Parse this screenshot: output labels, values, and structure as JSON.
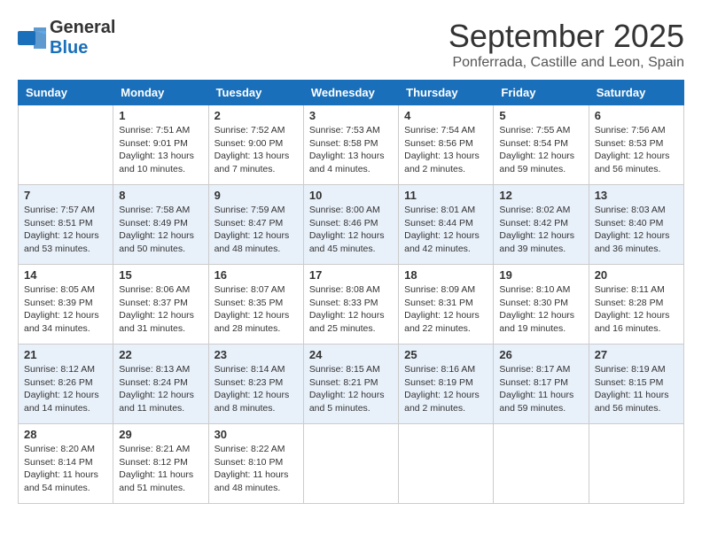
{
  "header": {
    "logo_general": "General",
    "logo_blue": "Blue",
    "month": "September 2025",
    "location": "Ponferrada, Castille and Leon, Spain"
  },
  "days_of_week": [
    "Sunday",
    "Monday",
    "Tuesday",
    "Wednesday",
    "Thursday",
    "Friday",
    "Saturday"
  ],
  "weeks": [
    [
      {
        "day": "",
        "empty": true
      },
      {
        "day": "1",
        "sunrise": "Sunrise: 7:51 AM",
        "sunset": "Sunset: 9:01 PM",
        "daylight": "Daylight: 13 hours and 10 minutes."
      },
      {
        "day": "2",
        "sunrise": "Sunrise: 7:52 AM",
        "sunset": "Sunset: 9:00 PM",
        "daylight": "Daylight: 13 hours and 7 minutes."
      },
      {
        "day": "3",
        "sunrise": "Sunrise: 7:53 AM",
        "sunset": "Sunset: 8:58 PM",
        "daylight": "Daylight: 13 hours and 4 minutes."
      },
      {
        "day": "4",
        "sunrise": "Sunrise: 7:54 AM",
        "sunset": "Sunset: 8:56 PM",
        "daylight": "Daylight: 13 hours and 2 minutes."
      },
      {
        "day": "5",
        "sunrise": "Sunrise: 7:55 AM",
        "sunset": "Sunset: 8:54 PM",
        "daylight": "Daylight: 12 hours and 59 minutes."
      },
      {
        "day": "6",
        "sunrise": "Sunrise: 7:56 AM",
        "sunset": "Sunset: 8:53 PM",
        "daylight": "Daylight: 12 hours and 56 minutes."
      }
    ],
    [
      {
        "day": "7",
        "sunrise": "Sunrise: 7:57 AM",
        "sunset": "Sunset: 8:51 PM",
        "daylight": "Daylight: 12 hours and 53 minutes."
      },
      {
        "day": "8",
        "sunrise": "Sunrise: 7:58 AM",
        "sunset": "Sunset: 8:49 PM",
        "daylight": "Daylight: 12 hours and 50 minutes."
      },
      {
        "day": "9",
        "sunrise": "Sunrise: 7:59 AM",
        "sunset": "Sunset: 8:47 PM",
        "daylight": "Daylight: 12 hours and 48 minutes."
      },
      {
        "day": "10",
        "sunrise": "Sunrise: 8:00 AM",
        "sunset": "Sunset: 8:46 PM",
        "daylight": "Daylight: 12 hours and 45 minutes."
      },
      {
        "day": "11",
        "sunrise": "Sunrise: 8:01 AM",
        "sunset": "Sunset: 8:44 PM",
        "daylight": "Daylight: 12 hours and 42 minutes."
      },
      {
        "day": "12",
        "sunrise": "Sunrise: 8:02 AM",
        "sunset": "Sunset: 8:42 PM",
        "daylight": "Daylight: 12 hours and 39 minutes."
      },
      {
        "day": "13",
        "sunrise": "Sunrise: 8:03 AM",
        "sunset": "Sunset: 8:40 PM",
        "daylight": "Daylight: 12 hours and 36 minutes."
      }
    ],
    [
      {
        "day": "14",
        "sunrise": "Sunrise: 8:05 AM",
        "sunset": "Sunset: 8:39 PM",
        "daylight": "Daylight: 12 hours and 34 minutes."
      },
      {
        "day": "15",
        "sunrise": "Sunrise: 8:06 AM",
        "sunset": "Sunset: 8:37 PM",
        "daylight": "Daylight: 12 hours and 31 minutes."
      },
      {
        "day": "16",
        "sunrise": "Sunrise: 8:07 AM",
        "sunset": "Sunset: 8:35 PM",
        "daylight": "Daylight: 12 hours and 28 minutes."
      },
      {
        "day": "17",
        "sunrise": "Sunrise: 8:08 AM",
        "sunset": "Sunset: 8:33 PM",
        "daylight": "Daylight: 12 hours and 25 minutes."
      },
      {
        "day": "18",
        "sunrise": "Sunrise: 8:09 AM",
        "sunset": "Sunset: 8:31 PM",
        "daylight": "Daylight: 12 hours and 22 minutes."
      },
      {
        "day": "19",
        "sunrise": "Sunrise: 8:10 AM",
        "sunset": "Sunset: 8:30 PM",
        "daylight": "Daylight: 12 hours and 19 minutes."
      },
      {
        "day": "20",
        "sunrise": "Sunrise: 8:11 AM",
        "sunset": "Sunset: 8:28 PM",
        "daylight": "Daylight: 12 hours and 16 minutes."
      }
    ],
    [
      {
        "day": "21",
        "sunrise": "Sunrise: 8:12 AM",
        "sunset": "Sunset: 8:26 PM",
        "daylight": "Daylight: 12 hours and 14 minutes."
      },
      {
        "day": "22",
        "sunrise": "Sunrise: 8:13 AM",
        "sunset": "Sunset: 8:24 PM",
        "daylight": "Daylight: 12 hours and 11 minutes."
      },
      {
        "day": "23",
        "sunrise": "Sunrise: 8:14 AM",
        "sunset": "Sunset: 8:23 PM",
        "daylight": "Daylight: 12 hours and 8 minutes."
      },
      {
        "day": "24",
        "sunrise": "Sunrise: 8:15 AM",
        "sunset": "Sunset: 8:21 PM",
        "daylight": "Daylight: 12 hours and 5 minutes."
      },
      {
        "day": "25",
        "sunrise": "Sunrise: 8:16 AM",
        "sunset": "Sunset: 8:19 PM",
        "daylight": "Daylight: 12 hours and 2 minutes."
      },
      {
        "day": "26",
        "sunrise": "Sunrise: 8:17 AM",
        "sunset": "Sunset: 8:17 PM",
        "daylight": "Daylight: 11 hours and 59 minutes."
      },
      {
        "day": "27",
        "sunrise": "Sunrise: 8:19 AM",
        "sunset": "Sunset: 8:15 PM",
        "daylight": "Daylight: 11 hours and 56 minutes."
      }
    ],
    [
      {
        "day": "28",
        "sunrise": "Sunrise: 8:20 AM",
        "sunset": "Sunset: 8:14 PM",
        "daylight": "Daylight: 11 hours and 54 minutes."
      },
      {
        "day": "29",
        "sunrise": "Sunrise: 8:21 AM",
        "sunset": "Sunset: 8:12 PM",
        "daylight": "Daylight: 11 hours and 51 minutes."
      },
      {
        "day": "30",
        "sunrise": "Sunrise: 8:22 AM",
        "sunset": "Sunset: 8:10 PM",
        "daylight": "Daylight: 11 hours and 48 minutes."
      },
      {
        "day": "",
        "empty": true
      },
      {
        "day": "",
        "empty": true
      },
      {
        "day": "",
        "empty": true
      },
      {
        "day": "",
        "empty": true
      }
    ]
  ]
}
